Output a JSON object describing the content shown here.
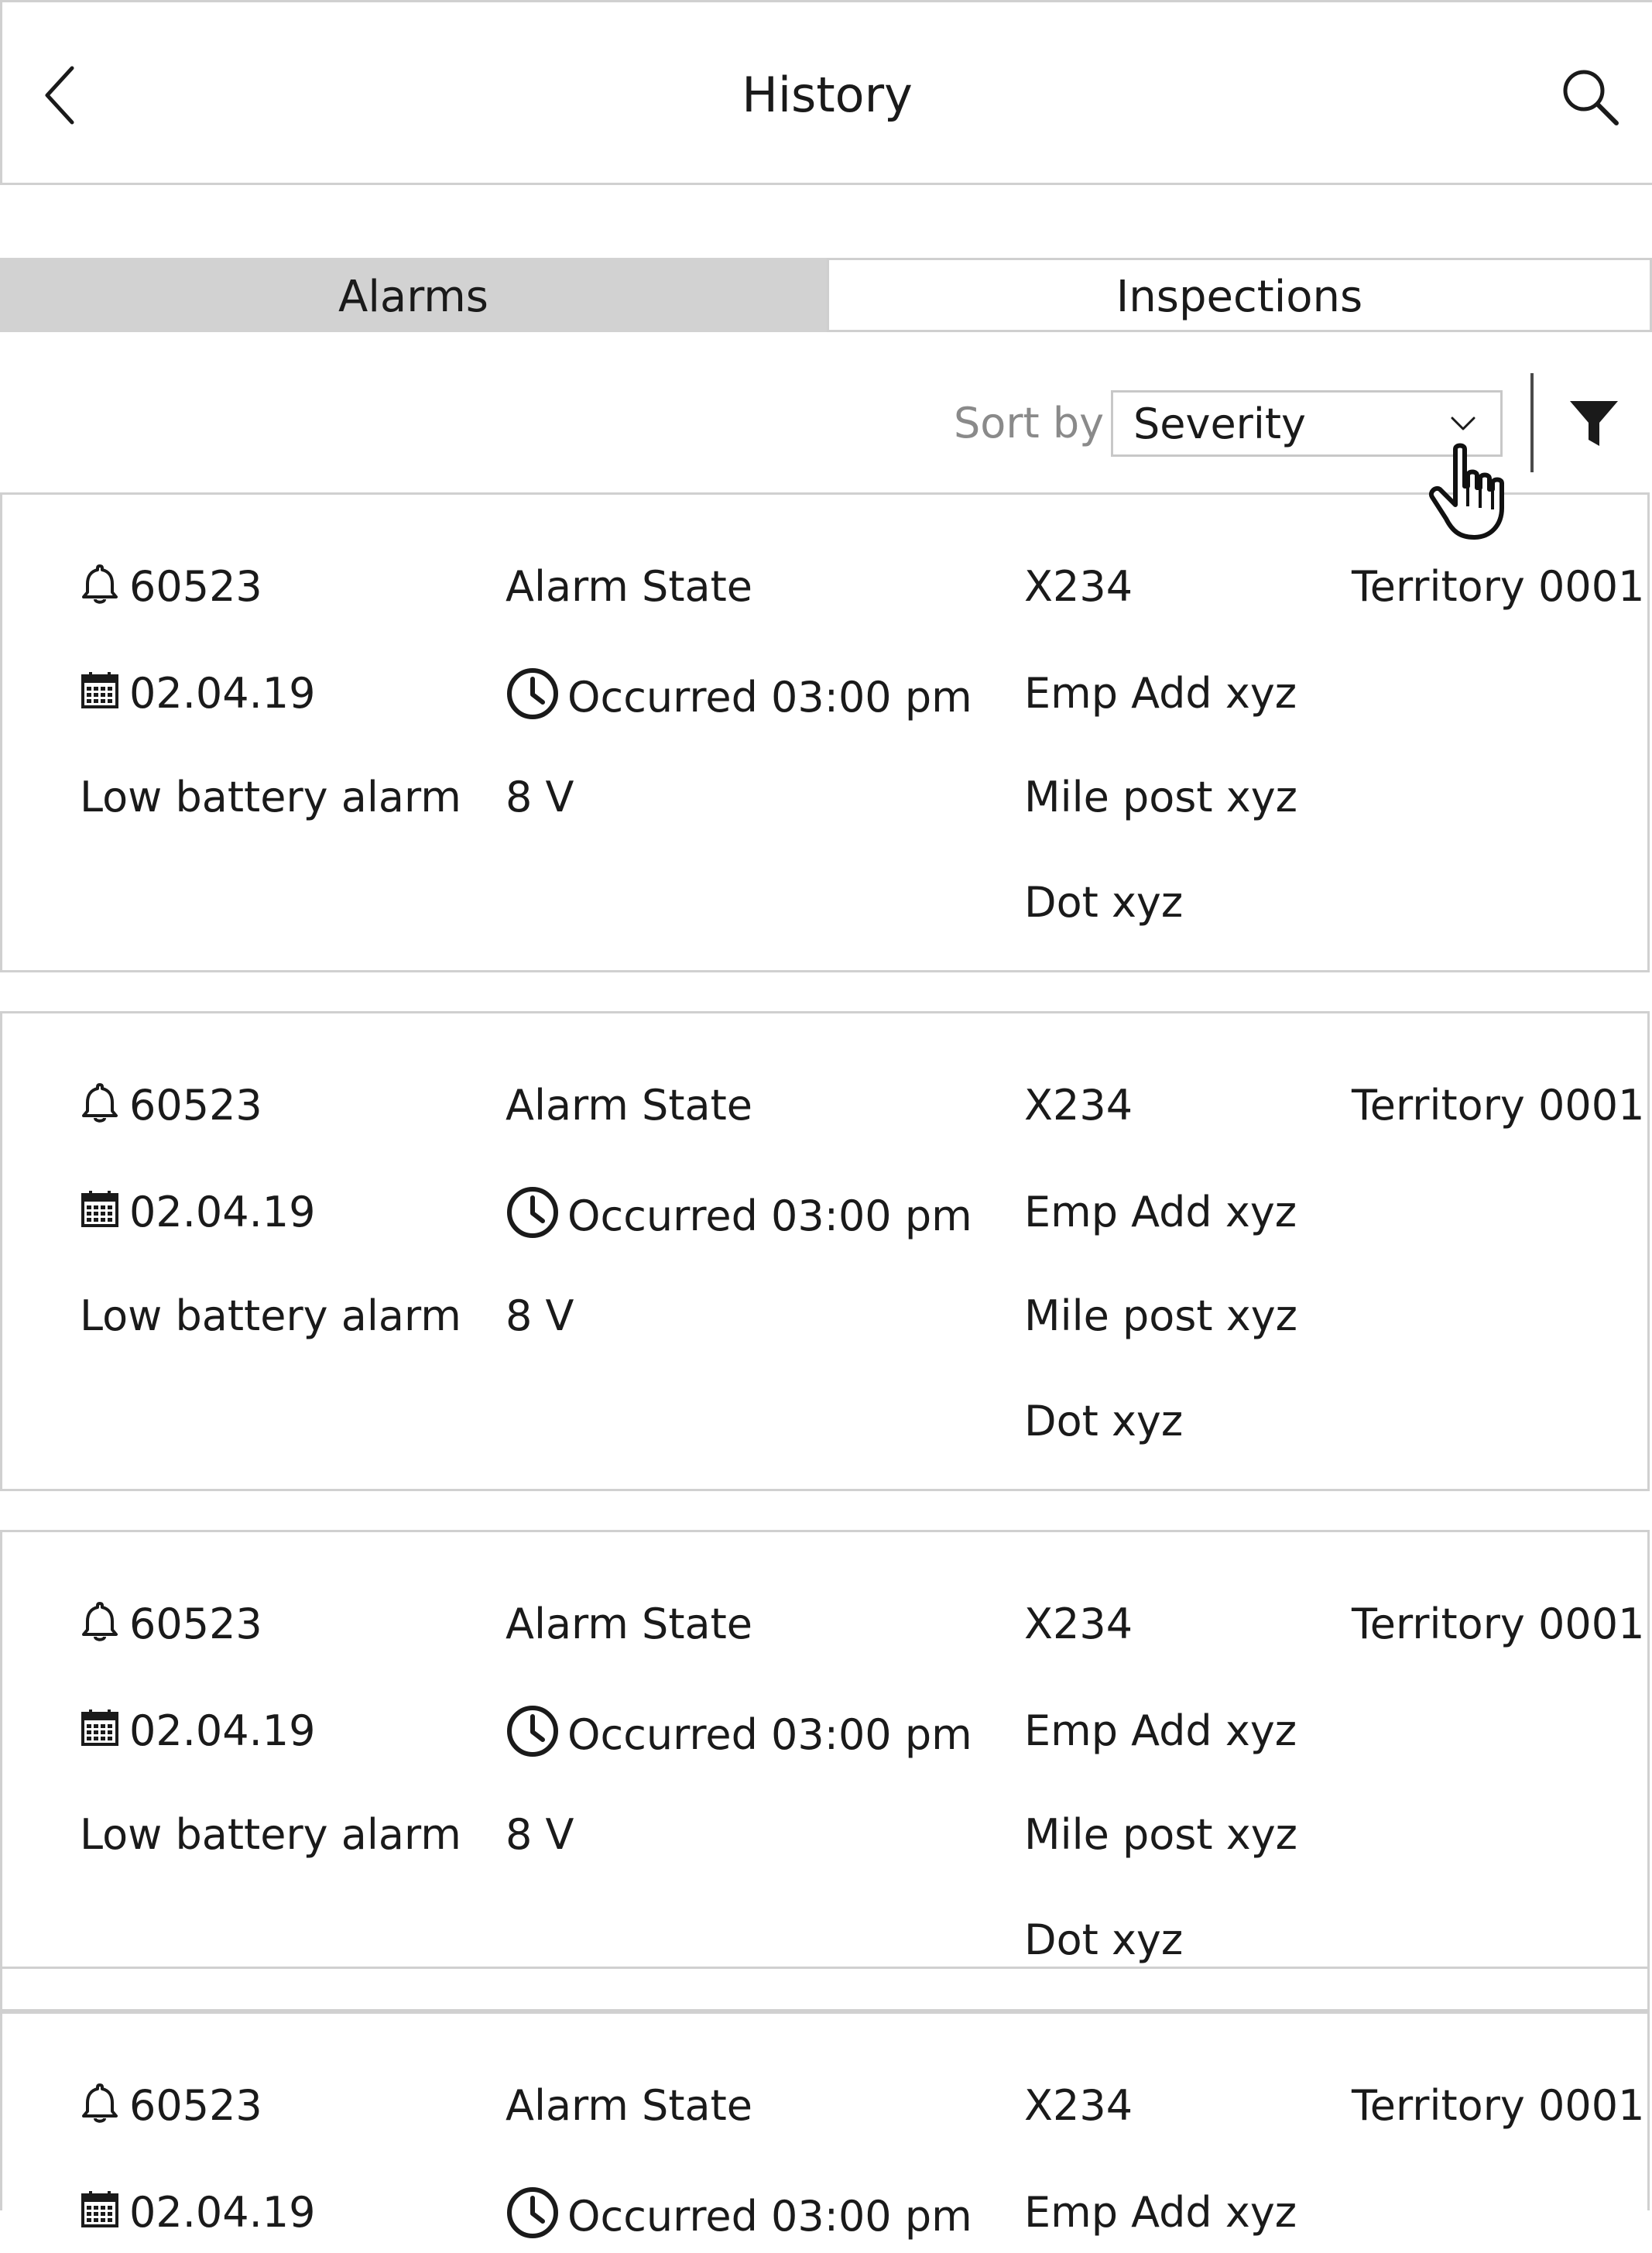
{
  "header": {
    "title": "History",
    "back_icon": "chevron-left-icon",
    "search_icon": "search-icon"
  },
  "tabs": [
    {
      "label": "Alarms",
      "active": true
    },
    {
      "label": "Inspections",
      "active": false
    }
  ],
  "sort": {
    "label": "Sort by",
    "selected": "Severity",
    "filter_icon": "filter-icon"
  },
  "cards": [
    {
      "alarm_id": "60523",
      "state": "Alarm State",
      "code": "X234",
      "territory": "Territory 0001",
      "date": "02.04.19",
      "occurred": "Occurred 03:00 pm",
      "emp_add": "Emp Add xyz",
      "description": "Low battery alarm",
      "voltage": "8 V",
      "mile_post": "Mile post xyz",
      "dot": "Dot xyz"
    },
    {
      "alarm_id": "60523",
      "state": "Alarm State",
      "code": "X234",
      "territory": "Territory 0001",
      "date": "02.04.19",
      "occurred": "Occurred 03:00 pm",
      "emp_add": "Emp Add xyz",
      "description": "Low battery alarm",
      "voltage": "8 V",
      "mile_post": "Mile post xyz",
      "dot": "Dot xyz"
    },
    {
      "alarm_id": "60523",
      "state": "Alarm State",
      "code": "X234",
      "territory": "Territory 0001",
      "date": "02.04.19",
      "occurred": "Occurred 03:00 pm",
      "emp_add": "Emp Add xyz",
      "description": "Low battery alarm",
      "voltage": "8 V",
      "mile_post": "Mile post xyz",
      "dot": "Dot xyz"
    },
    {
      "alarm_id": "60523",
      "state": "Alarm State",
      "code": "X234",
      "territory": "Territory 0001",
      "date": "02.04.19",
      "occurred": "Occurred 03:00 pm",
      "emp_add": "Emp Add xyz"
    }
  ]
}
